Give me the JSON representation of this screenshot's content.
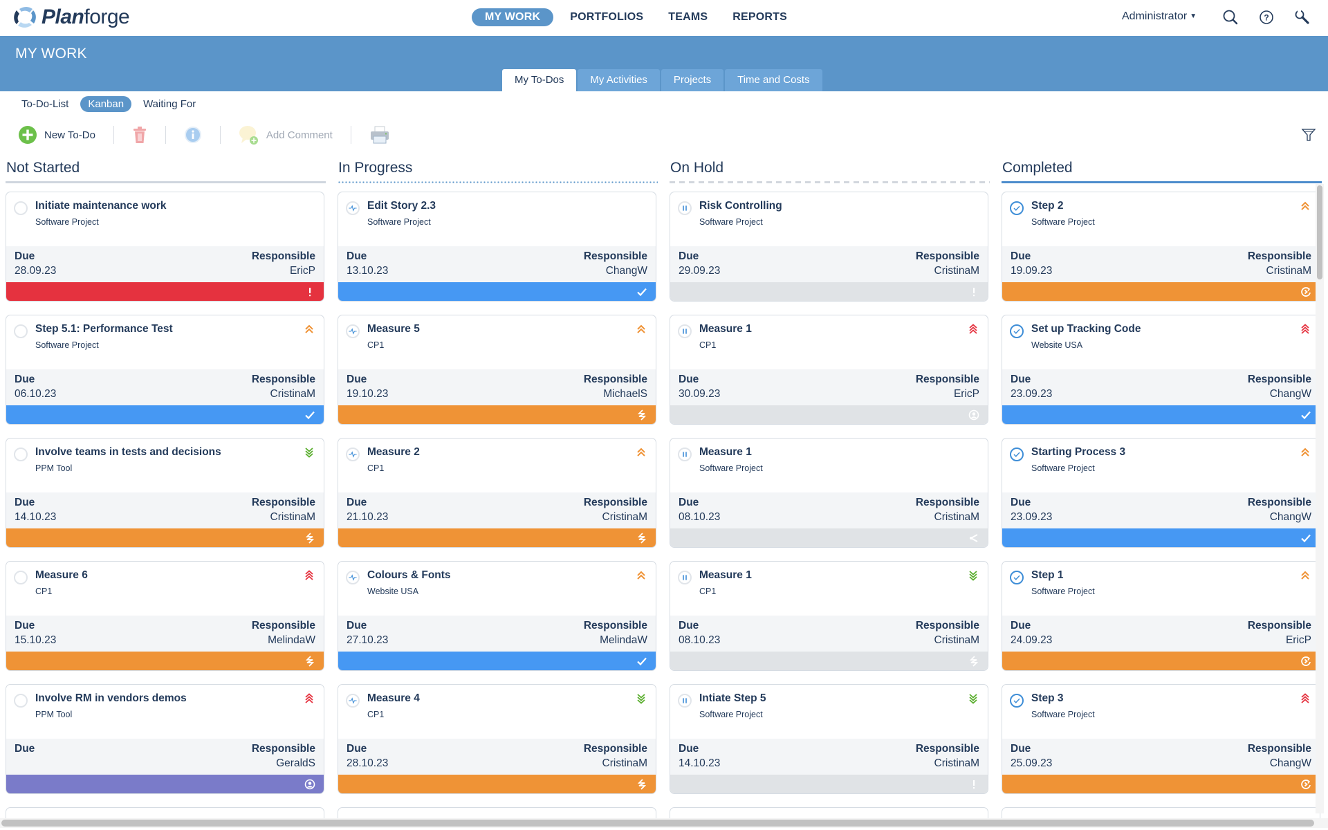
{
  "app": {
    "name_bold": "Plan",
    "name_rest": "forge"
  },
  "mainnav": {
    "items": [
      {
        "label": "MY WORK",
        "active": true
      },
      {
        "label": "PORTFOLIOS",
        "active": false
      },
      {
        "label": "TEAMS",
        "active": false
      },
      {
        "label": "REPORTS",
        "active": false
      }
    ]
  },
  "user": {
    "label": "Administrator",
    "icons": [
      "search-icon",
      "help-icon",
      "admin-tools-icon"
    ]
  },
  "band": {
    "title": "MY WORK"
  },
  "tabs": [
    {
      "label": "My To-Dos",
      "active": true
    },
    {
      "label": "My Activities",
      "active": false
    },
    {
      "label": "Projects",
      "active": false
    },
    {
      "label": "Time and Costs",
      "active": false
    }
  ],
  "subnav": [
    {
      "label": "To-Do-List",
      "active": false
    },
    {
      "label": "Kanban",
      "active": true
    },
    {
      "label": "Waiting For",
      "active": false
    }
  ],
  "toolbar": {
    "new_todo": "New To-Do",
    "add_comment": "Add Comment"
  },
  "labels": {
    "due": "Due",
    "responsible": "Responsible"
  },
  "colors": {
    "red": "#e5323f",
    "blue": "#4698f3",
    "orange": "#ef9336",
    "purple": "#7a7bc9",
    "gray": "#e0e3e6",
    "brand": "#5b95c9",
    "prio_red": "#e5323f",
    "prio_orange": "#ef9336",
    "prio_green": "#5aae2e"
  },
  "columns": [
    {
      "title": "Not Started",
      "status": "notstarted",
      "line": "solid-gray",
      "cards": [
        {
          "title": "Initiate maintenance work",
          "project": "Software Project",
          "due": "28.09.23",
          "responsible": "EricP",
          "priority": "",
          "bar": "red",
          "bar_icon": "exclamation-icon"
        },
        {
          "title": "Step 5.1: Performance Test",
          "project": "Software Project",
          "due": "06.10.23",
          "responsible": "CristinaM",
          "priority": "high",
          "bar": "blue",
          "bar_icon": "check-icon"
        },
        {
          "title": "Involve teams in tests and decisions",
          "project": "PPM Tool",
          "due": "14.10.23",
          "responsible": "CristinaM",
          "priority": "low",
          "bar": "orange",
          "bar_icon": "lightning-icon"
        },
        {
          "title": "Measure 6",
          "project": "CP1",
          "due": "15.10.23",
          "responsible": "MelindaW",
          "priority": "critical",
          "bar": "orange",
          "bar_icon": "lightning-icon"
        },
        {
          "title": "Involve RM in vendors demos",
          "project": "PPM Tool",
          "due": "",
          "responsible": "GeraldS",
          "priority": "critical",
          "bar": "purple",
          "bar_icon": "user-icon"
        }
      ]
    },
    {
      "title": "In Progress",
      "status": "inprogress",
      "line": "dotted",
      "cards": [
        {
          "title": "Edit Story 2.3",
          "project": "Software Project",
          "due": "13.10.23",
          "responsible": "ChangW",
          "priority": "",
          "bar": "blue",
          "bar_icon": "check-icon"
        },
        {
          "title": "Measure 5",
          "project": "CP1",
          "due": "19.10.23",
          "responsible": "MichaelS",
          "priority": "high",
          "bar": "orange",
          "bar_icon": "lightning-icon"
        },
        {
          "title": "Measure 2",
          "project": "CP1",
          "due": "21.10.23",
          "responsible": "CristinaM",
          "priority": "high",
          "bar": "orange",
          "bar_icon": "lightning-icon"
        },
        {
          "title": "Colours & Fonts",
          "project": "Website USA",
          "due": "27.10.23",
          "responsible": "MelindaW",
          "priority": "high",
          "bar": "blue",
          "bar_icon": "check-icon"
        },
        {
          "title": "Measure 4",
          "project": "CP1",
          "due": "28.10.23",
          "responsible": "CristinaM",
          "priority": "low",
          "bar": "orange",
          "bar_icon": "lightning-icon"
        }
      ]
    },
    {
      "title": "On Hold",
      "status": "onhold",
      "line": "dashed",
      "cards": [
        {
          "title": "Risk Controlling",
          "project": "Software Project",
          "due": "29.09.23",
          "responsible": "CristinaM",
          "priority": "",
          "bar": "gray",
          "bar_icon": "exclamation-icon"
        },
        {
          "title": "Measure 1",
          "project": "CP1",
          "due": "30.09.23",
          "responsible": "EricP",
          "priority": "critical",
          "bar": "gray",
          "bar_icon": "user-icon"
        },
        {
          "title": "Measure 1",
          "project": "Software Project",
          "due": "08.10.23",
          "responsible": "CristinaM",
          "priority": "",
          "bar": "gray",
          "bar_icon": "share-icon"
        },
        {
          "title": "Measure 1",
          "project": "CP1",
          "due": "08.10.23",
          "responsible": "CristinaM",
          "priority": "low",
          "bar": "gray",
          "bar_icon": "lightning-icon"
        },
        {
          "title": "Intiate Step 5",
          "project": "Software Project",
          "due": "14.10.23",
          "responsible": "CristinaM",
          "priority": "low",
          "bar": "gray",
          "bar_icon": "exclamation-icon"
        }
      ]
    },
    {
      "title": "Completed",
      "status": "completed",
      "line": "solid-blue",
      "cards": [
        {
          "title": "Step 2",
          "project": "Software Project",
          "due": "19.09.23",
          "responsible": "CristinaM",
          "priority": "high",
          "bar": "orange",
          "bar_icon": "refresh-icon"
        },
        {
          "title": "Set up Tracking Code",
          "project": "Website USA",
          "due": "23.09.23",
          "responsible": "ChangW",
          "priority": "critical",
          "bar": "blue",
          "bar_icon": "check-icon"
        },
        {
          "title": "Starting Process 3",
          "project": "Software Project",
          "due": "23.09.23",
          "responsible": "ChangW",
          "priority": "high",
          "bar": "blue",
          "bar_icon": "check-icon"
        },
        {
          "title": "Step 1",
          "project": "Software Project",
          "due": "24.09.23",
          "responsible": "EricP",
          "priority": "high",
          "bar": "orange",
          "bar_icon": "refresh-icon"
        },
        {
          "title": "Step 3",
          "project": "Software Project",
          "due": "25.09.23",
          "responsible": "ChangW",
          "priority": "critical",
          "bar": "orange",
          "bar_icon": "refresh-icon"
        }
      ]
    }
  ]
}
